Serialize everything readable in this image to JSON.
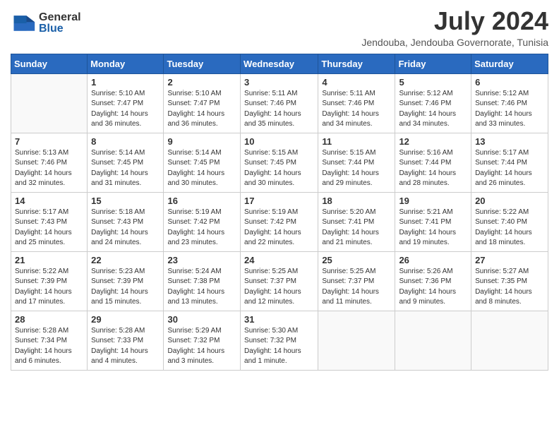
{
  "header": {
    "logo_general": "General",
    "logo_blue": "Blue",
    "month_year": "July 2024",
    "location": "Jendouba, Jendouba Governorate, Tunisia"
  },
  "weekdays": [
    "Sunday",
    "Monday",
    "Tuesday",
    "Wednesday",
    "Thursday",
    "Friday",
    "Saturday"
  ],
  "weeks": [
    [
      {
        "day": "",
        "info": ""
      },
      {
        "day": "1",
        "info": "Sunrise: 5:10 AM\nSunset: 7:47 PM\nDaylight: 14 hours\nand 36 minutes."
      },
      {
        "day": "2",
        "info": "Sunrise: 5:10 AM\nSunset: 7:47 PM\nDaylight: 14 hours\nand 36 minutes."
      },
      {
        "day": "3",
        "info": "Sunrise: 5:11 AM\nSunset: 7:46 PM\nDaylight: 14 hours\nand 35 minutes."
      },
      {
        "day": "4",
        "info": "Sunrise: 5:11 AM\nSunset: 7:46 PM\nDaylight: 14 hours\nand 34 minutes."
      },
      {
        "day": "5",
        "info": "Sunrise: 5:12 AM\nSunset: 7:46 PM\nDaylight: 14 hours\nand 34 minutes."
      },
      {
        "day": "6",
        "info": "Sunrise: 5:12 AM\nSunset: 7:46 PM\nDaylight: 14 hours\nand 33 minutes."
      }
    ],
    [
      {
        "day": "7",
        "info": "Sunrise: 5:13 AM\nSunset: 7:46 PM\nDaylight: 14 hours\nand 32 minutes."
      },
      {
        "day": "8",
        "info": "Sunrise: 5:14 AM\nSunset: 7:45 PM\nDaylight: 14 hours\nand 31 minutes."
      },
      {
        "day": "9",
        "info": "Sunrise: 5:14 AM\nSunset: 7:45 PM\nDaylight: 14 hours\nand 30 minutes."
      },
      {
        "day": "10",
        "info": "Sunrise: 5:15 AM\nSunset: 7:45 PM\nDaylight: 14 hours\nand 30 minutes."
      },
      {
        "day": "11",
        "info": "Sunrise: 5:15 AM\nSunset: 7:44 PM\nDaylight: 14 hours\nand 29 minutes."
      },
      {
        "day": "12",
        "info": "Sunrise: 5:16 AM\nSunset: 7:44 PM\nDaylight: 14 hours\nand 28 minutes."
      },
      {
        "day": "13",
        "info": "Sunrise: 5:17 AM\nSunset: 7:44 PM\nDaylight: 14 hours\nand 26 minutes."
      }
    ],
    [
      {
        "day": "14",
        "info": "Sunrise: 5:17 AM\nSunset: 7:43 PM\nDaylight: 14 hours\nand 25 minutes."
      },
      {
        "day": "15",
        "info": "Sunrise: 5:18 AM\nSunset: 7:43 PM\nDaylight: 14 hours\nand 24 minutes."
      },
      {
        "day": "16",
        "info": "Sunrise: 5:19 AM\nSunset: 7:42 PM\nDaylight: 14 hours\nand 23 minutes."
      },
      {
        "day": "17",
        "info": "Sunrise: 5:19 AM\nSunset: 7:42 PM\nDaylight: 14 hours\nand 22 minutes."
      },
      {
        "day": "18",
        "info": "Sunrise: 5:20 AM\nSunset: 7:41 PM\nDaylight: 14 hours\nand 21 minutes."
      },
      {
        "day": "19",
        "info": "Sunrise: 5:21 AM\nSunset: 7:41 PM\nDaylight: 14 hours\nand 19 minutes."
      },
      {
        "day": "20",
        "info": "Sunrise: 5:22 AM\nSunset: 7:40 PM\nDaylight: 14 hours\nand 18 minutes."
      }
    ],
    [
      {
        "day": "21",
        "info": "Sunrise: 5:22 AM\nSunset: 7:39 PM\nDaylight: 14 hours\nand 17 minutes."
      },
      {
        "day": "22",
        "info": "Sunrise: 5:23 AM\nSunset: 7:39 PM\nDaylight: 14 hours\nand 15 minutes."
      },
      {
        "day": "23",
        "info": "Sunrise: 5:24 AM\nSunset: 7:38 PM\nDaylight: 14 hours\nand 13 minutes."
      },
      {
        "day": "24",
        "info": "Sunrise: 5:25 AM\nSunset: 7:37 PM\nDaylight: 14 hours\nand 12 minutes."
      },
      {
        "day": "25",
        "info": "Sunrise: 5:25 AM\nSunset: 7:37 PM\nDaylight: 14 hours\nand 11 minutes."
      },
      {
        "day": "26",
        "info": "Sunrise: 5:26 AM\nSunset: 7:36 PM\nDaylight: 14 hours\nand 9 minutes."
      },
      {
        "day": "27",
        "info": "Sunrise: 5:27 AM\nSunset: 7:35 PM\nDaylight: 14 hours\nand 8 minutes."
      }
    ],
    [
      {
        "day": "28",
        "info": "Sunrise: 5:28 AM\nSunset: 7:34 PM\nDaylight: 14 hours\nand 6 minutes."
      },
      {
        "day": "29",
        "info": "Sunrise: 5:28 AM\nSunset: 7:33 PM\nDaylight: 14 hours\nand 4 minutes."
      },
      {
        "day": "30",
        "info": "Sunrise: 5:29 AM\nSunset: 7:32 PM\nDaylight: 14 hours\nand 3 minutes."
      },
      {
        "day": "31",
        "info": "Sunrise: 5:30 AM\nSunset: 7:32 PM\nDaylight: 14 hours\nand 1 minute."
      },
      {
        "day": "",
        "info": ""
      },
      {
        "day": "",
        "info": ""
      },
      {
        "day": "",
        "info": ""
      }
    ]
  ]
}
